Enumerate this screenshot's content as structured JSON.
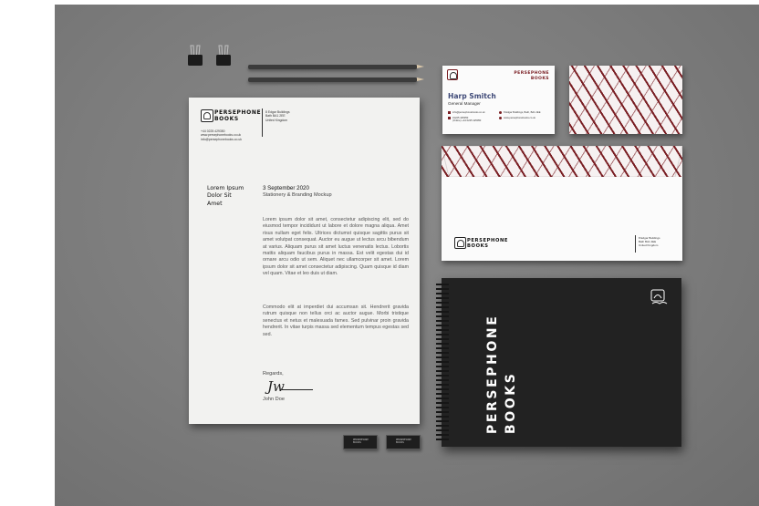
{
  "letterhead": {
    "brand_line1": "PERSEPHONE",
    "brand_line2": "BOOKS",
    "address": "8 Edgar Buildings\nBath BA1 2EE\nUnited Kingdom",
    "contact": "+44 0225 429350\nwww.persephonebooks.co.uk\ninfo@persephonebooks.co.uk",
    "side_heading": "Lorem Ipsum\nDolor Sit\nAmet",
    "date": "3 September 2020",
    "subject": "Stationery & Branding Mockup",
    "paragraph1": "Lorem ipsum dolor sit amet, consectetur adipiscing elit, sed do eiusmod tempor incididunt ut labore et dolore magna aliqua. Amet risus nullam eget felis. Ultrices dictumst quisque sagittis purus sit amet volutpat consequat. Auctor eu augue ut lectus arcu bibendum at varius. Aliquam purus sit amet luctus venenatis lectus. Lobortis mattis aliquam faucibus purus in massa. Est velit egestas dui id ornare arcu odio ut sem. Aliquet nec ullamcorper sit amet. Lorem ipsum dolor sit amet consectetur adipiscing. Quam quisque id diam vel quam. Vitae et leo duis ut diam.",
    "paragraph2": "Commodo elit at imperdiet dui accumsan sit. Hendrerit gravida rutrum quisque non tellus orci ac auctor augue. Morbi tristique senectus et netus et malesuada fames. Sed pulvinar proin gravida hendrerit. In vitae turpis massa sed elementum tempus egestas sed sed.",
    "regards": "Regards,",
    "signature": "Jw",
    "signer": "John Doe"
  },
  "business_card": {
    "brand_line1": "PERSEPHONE",
    "brand_line2": "BOOKS",
    "name": "Harp Smitch",
    "title": "General Manager",
    "email": "info@persephonebooks.co.uk",
    "phone": "01225 425050\n(Online) +44 0225 425050",
    "address": "8 Edgar Buildings, Bath, BA1 2EE",
    "website": "www.persephonebooks.co.uk"
  },
  "envelope": {
    "brand_line1": "PERSEPHONE",
    "brand_line2": "BOOKS",
    "address": "8 Edgar Buildings\nBath BA1 2EE\nUnited Kingdom"
  },
  "notebook": {
    "title_line1": "PERSEPHONE",
    "title_line2": "BOOKS"
  },
  "erasers": {
    "label": "PERSEPHONE\nBOOKS"
  },
  "colors": {
    "accent": "#7a1f24",
    "name_blue": "#3f4a78",
    "notebook": "#222222",
    "background": "#7c7c7c"
  }
}
